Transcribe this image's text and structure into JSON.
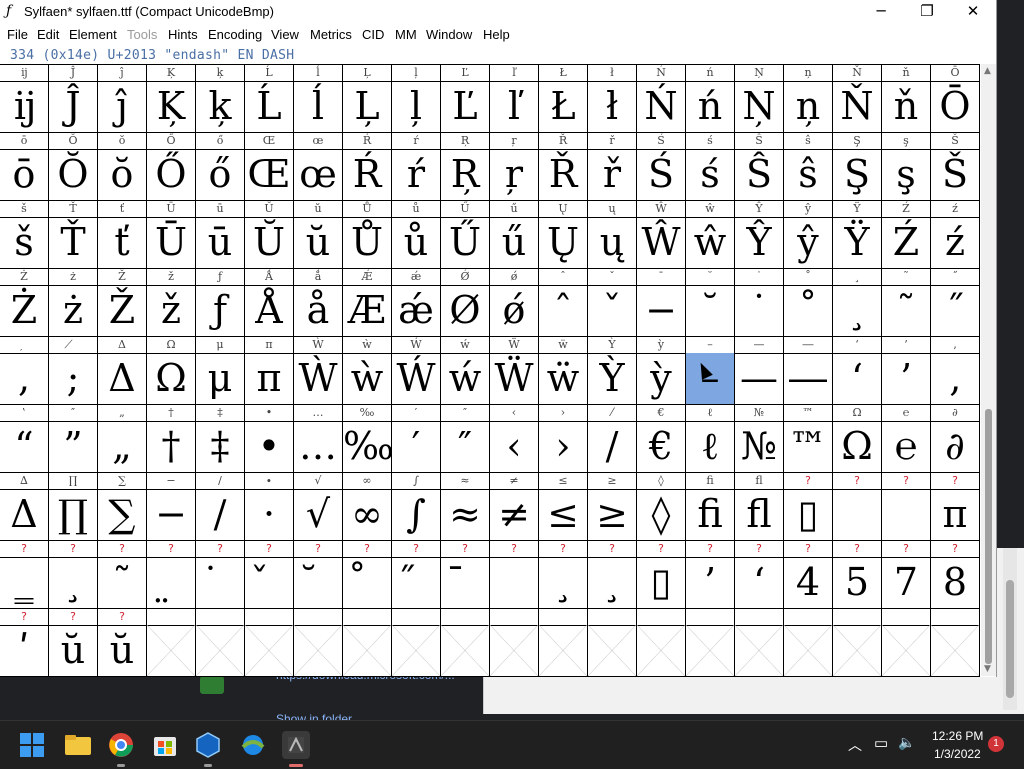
{
  "window": {
    "title": "Sylfaen* sylfaen.ttf (Compact UnicodeBmp)",
    "minimize": "─",
    "maximize": "❐",
    "close": "✕"
  },
  "menu": [
    "File",
    "Edit",
    "Element",
    "Tools",
    "Hints",
    "Encoding",
    "View",
    "Metrics",
    "CID",
    "MM",
    "Window",
    "Help"
  ],
  "info": "334 (0x14e) U+2013 \"endash\" EN DASH",
  "rows": [
    {
      "labels": [
        "ĳ",
        "Ĵ",
        "ĵ",
        "Ķ",
        "ķ",
        "Ĺ",
        "ĺ",
        "Ļ",
        "ļ",
        "Ľ",
        "ľ",
        "Ł",
        "ł",
        "Ń",
        "ń",
        "Ņ",
        "ņ",
        "Ň",
        "ň",
        "Ō"
      ],
      "glyphs": [
        "ĳ",
        "Ĵ",
        "ĵ",
        "Ķ",
        "ķ",
        "Ĺ",
        "ĺ",
        "Ļ",
        "ļ",
        "Ľ",
        "ľ",
        "Ł",
        "ł",
        "Ń",
        "ń",
        "Ņ",
        "ņ",
        "Ň",
        "ň",
        "Ō"
      ]
    },
    {
      "labels": [
        "ō",
        "Ŏ",
        "ŏ",
        "Ő",
        "ő",
        "Œ",
        "œ",
        "Ŕ",
        "ŕ",
        "Ŗ",
        "ŗ",
        "Ř",
        "ř",
        "Ś",
        "ś",
        "Ŝ",
        "ŝ",
        "Ş",
        "ş",
        "Š"
      ],
      "glyphs": [
        "ō",
        "Ŏ",
        "ŏ",
        "Ő",
        "ő",
        "Œ",
        "œ",
        "Ŕ",
        "ŕ",
        "Ŗ",
        "ŗ",
        "Ř",
        "ř",
        "Ś",
        "ś",
        "Ŝ",
        "ŝ",
        "Ş",
        "ş",
        "Š"
      ]
    },
    {
      "labels": [
        "š",
        "Ť",
        "ť",
        "Ū",
        "ū",
        "Ŭ",
        "ŭ",
        "Ů",
        "ů",
        "Ű",
        "ű",
        "Ų",
        "ų",
        "Ŵ",
        "ŵ",
        "Ŷ",
        "ŷ",
        "Ÿ",
        "Ź",
        "ź"
      ],
      "glyphs": [
        "š",
        "Ť",
        "ť",
        "Ū",
        "ū",
        "Ŭ",
        "ŭ",
        "Ů",
        "ů",
        "Ű",
        "ű",
        "Ų",
        "ų",
        "Ŵ",
        "ŵ",
        "Ŷ",
        "ŷ",
        "Ÿ",
        "Ź",
        "ź"
      ]
    },
    {
      "labels": [
        "Ż",
        "ż",
        "Ž",
        "ž",
        "ƒ",
        "Ǻ",
        "ǻ",
        "Ǽ",
        "ǽ",
        "Ǿ",
        "ǿ",
        "ˆ",
        "ˇ",
        "¯",
        "˘",
        "˙",
        "˚",
        "¸",
        "˜",
        "˝"
      ],
      "glyphs": [
        "Ż",
        "ż",
        "Ž",
        "ž",
        "ƒ",
        "Å",
        "å",
        "Æ",
        "ǽ",
        "Ø",
        "ǿ",
        "ˆ",
        "ˇ",
        "−",
        "˘",
        "˙",
        "˚",
        "¸",
        "˜",
        "˝"
      ]
    },
    {
      "labels": [
        "̦",
        "̸",
        "Δ",
        "Ω",
        "μ",
        "π",
        "Ẁ",
        "ẁ",
        "Ẃ",
        "ẃ",
        "Ẅ",
        "ẅ",
        "Ỳ",
        "ỳ",
        "–",
        "—",
        "―",
        "‘",
        "’",
        "‚"
      ],
      "glyphs": [
        ",",
        ";",
        "Δ",
        "Ω",
        "μ",
        "π",
        "Ẁ",
        "ẁ",
        "Ẃ",
        "ẃ",
        "Ẅ",
        "ẅ",
        "Ỳ",
        "ỳ",
        "–",
        "—",
        "―",
        "‘",
        "’",
        "‚"
      ]
    },
    {
      "labels": [
        "‛",
        "″",
        "„",
        "†",
        "‡",
        "•",
        "…",
        "‰",
        "′",
        "″",
        "‹",
        "›",
        "⁄",
        "€",
        "ℓ",
        "№",
        "™",
        "Ω",
        "℮",
        "∂"
      ],
      "glyphs": [
        "“",
        "”",
        "„",
        "†",
        "‡",
        "•",
        "…",
        "‰",
        "′",
        "″",
        "‹",
        "›",
        "/",
        "€",
        "ℓ",
        "№",
        "™",
        "Ω",
        "℮",
        "∂"
      ]
    },
    {
      "labels": [
        "∆",
        "∏",
        "∑",
        "−",
        "∕",
        "∙",
        "√",
        "∞",
        "∫",
        "≈",
        "≠",
        "≤",
        "≥",
        "◊",
        "ﬁ",
        "ﬂ",
        "?",
        "?",
        "?",
        "?"
      ],
      "glyphs": [
        "Δ",
        "∏",
        "∑",
        "−",
        "∕",
        "·",
        "√",
        "∞",
        "∫",
        "≈",
        "≠",
        "≤",
        "≥",
        "◊",
        "ﬁ",
        "ﬂ",
        "▯",
        "",
        "",
        "π"
      ]
    },
    {
      "labels": [
        "?",
        "?",
        "?",
        "?",
        "?",
        "?",
        "?",
        "?",
        "?",
        "?",
        "?",
        "?",
        "?",
        "?",
        "?",
        "?",
        "?",
        "?",
        "?",
        "?"
      ],
      "glyphs": [
        "‗",
        "¸",
        "˜",
        "̤",
        "̇",
        "̌",
        "̆",
        "̊",
        "̋",
        "̄",
        "",
        "¸",
        "¸",
        "▯",
        "’",
        "‘",
        "4",
        "5",
        "7",
        "8"
      ]
    },
    {
      "labels": [
        "?",
        "?",
        "?",
        "",
        "",
        "",
        "",
        "",
        "",
        "",
        "",
        "",
        "",
        "",
        "",
        "",
        "",
        "",
        "",
        ""
      ],
      "glyphs": [
        "ʹ",
        "ŭ",
        "ŭ",
        "",
        "",
        "",
        "",
        "",
        "",
        "",
        "",
        "",
        "",
        "",
        "",
        "",
        "",
        "",
        "",
        ""
      ]
    }
  ],
  "selected": {
    "row": 4,
    "col": 14
  },
  "background": {
    "link_text": "https://download.microsoft.com/...",
    "show_in_folder": "Show in folder"
  },
  "taskbar": {
    "time": "12:26 PM",
    "date": "1/3/2022",
    "notifications": "1",
    "apps": [
      "start-icon",
      "file-explorer-icon",
      "chrome-icon",
      "store-icon",
      "virtualbox-icon",
      "network-app-icon",
      "fontforge-icon"
    ]
  }
}
